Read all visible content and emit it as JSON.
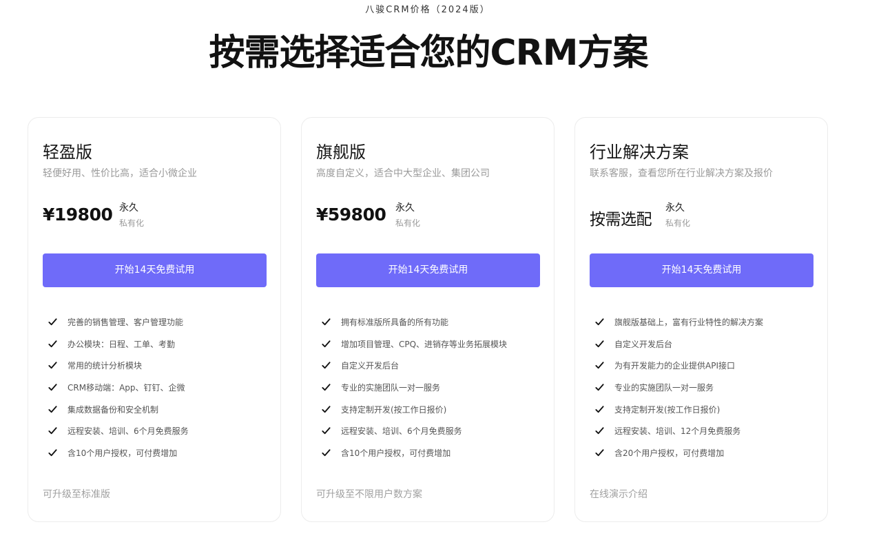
{
  "header": {
    "eyebrow": "八骏CRM价格（2024版）",
    "title": "按需选择适合您的CRM方案"
  },
  "plans": [
    {
      "name": "轻盈版",
      "description": "轻便好用、性价比高，适合小微企业",
      "price": "¥19800",
      "term": "永久",
      "deployment": "私有化",
      "cta": "开始14天免费试用",
      "features": [
        "完善的销售管理、客户管理功能",
        "办公模块：日程、工单、考勤",
        "常用的统计分析模块",
        "CRM移动端：App、钉钉、企微",
        "集成数据备份和安全机制",
        "远程安装、培训、6个月免费服务",
        "含10个用户授权，可付费增加"
      ],
      "footer_link": "可升级至标准版"
    },
    {
      "name": "旗舰版",
      "description": "高度自定义，适合中大型企业、集团公司",
      "price": "¥59800",
      "term": "永久",
      "deployment": "私有化",
      "cta": "开始14天免费试用",
      "features": [
        "拥有标准版所具备的所有功能",
        "增加项目管理、CPQ、进销存等业务拓展模块",
        "自定义开发后台",
        "专业的实施团队一对一服务",
        "支持定制开发(按工作日报价)",
        "远程安装、培训、6个月免费服务",
        "含10个用户授权，可付费增加"
      ],
      "footer_link": "可升级至不限用户数方案"
    },
    {
      "name": "行业解决方案",
      "description": "联系客服，查看您所在行业解决方案及报价",
      "price": "按需选配",
      "term": "永久",
      "deployment": "私有化",
      "cta": "开始14天免费试用",
      "features": [
        "旗舰版基础上，富有行业特性的解决方案",
        "自定义开发后台",
        "为有开发能力的企业提供API接口",
        "专业的实施团队一对一服务",
        "支持定制开发(按工作日报价)",
        "远程安装、培训、12个月免费服务",
        "含20个用户授权，可付费增加"
      ],
      "footer_link": "在线演示介绍"
    }
  ],
  "colors": {
    "accent": "#6f6bf9",
    "text_primary": "#111111",
    "text_muted": "#9a9a9a",
    "card_border": "#ececec"
  },
  "icons": {
    "feature_bullet": "check-icon"
  }
}
